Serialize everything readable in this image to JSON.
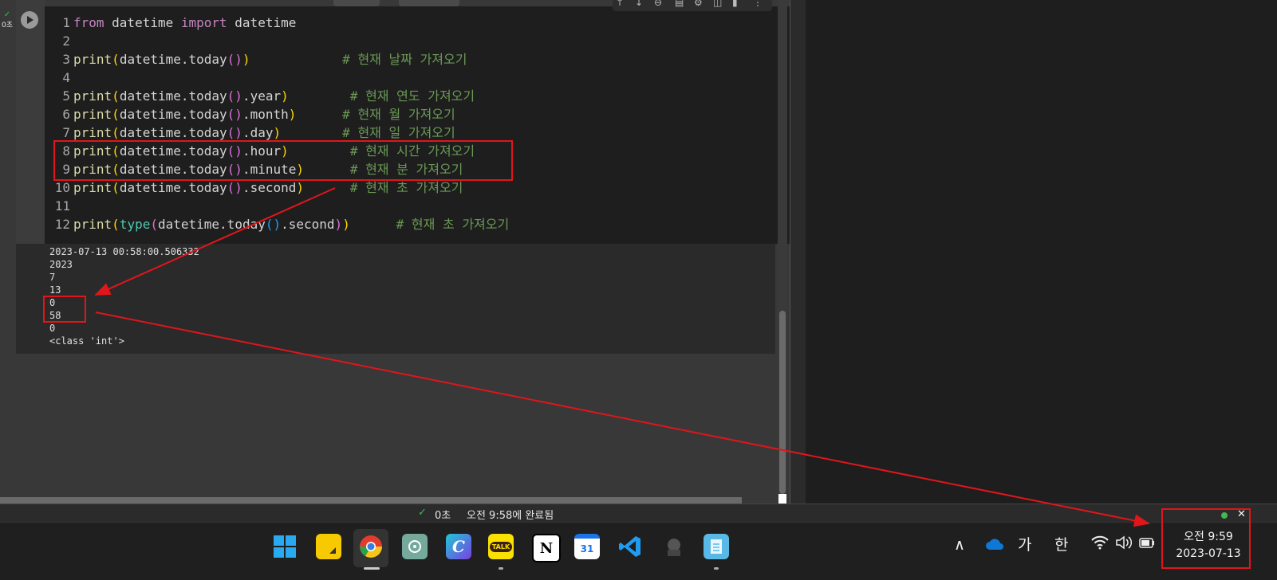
{
  "cell": {
    "status_check": "✓",
    "status_time": "0초",
    "run_icon": "play-icon",
    "toolbar_icons": [
      "arrow-up-icon",
      "arrow-down-icon",
      "link-icon",
      "comment-icon",
      "gear-icon",
      "mirror-icon",
      "trash-icon",
      "more-icon"
    ]
  },
  "code_lines": [
    {
      "n": "1",
      "segments": [
        [
          "kw",
          "from"
        ],
        [
          "tx",
          " datetime "
        ],
        [
          "kw",
          "import"
        ],
        [
          "tx",
          " datetime"
        ]
      ]
    },
    {
      "n": "2",
      "segments": []
    },
    {
      "n": "3",
      "segments": [
        [
          "fn",
          "print"
        ],
        [
          "p1",
          "("
        ],
        [
          "tx",
          "datetime.today"
        ],
        [
          "p2",
          "()"
        ],
        [
          "p1",
          ")"
        ],
        [
          "tx",
          "            "
        ],
        [
          "cm",
          "# 현재 날짜 가져오기"
        ]
      ]
    },
    {
      "n": "4",
      "segments": []
    },
    {
      "n": "5",
      "segments": [
        [
          "fn",
          "print"
        ],
        [
          "p1",
          "("
        ],
        [
          "tx",
          "datetime.today"
        ],
        [
          "p2",
          "()"
        ],
        [
          "tx",
          ".year"
        ],
        [
          "p1",
          ")"
        ],
        [
          "tx",
          "        "
        ],
        [
          "cm",
          "# 현재 연도 가져오기"
        ]
      ]
    },
    {
      "n": "6",
      "segments": [
        [
          "fn",
          "print"
        ],
        [
          "p1",
          "("
        ],
        [
          "tx",
          "datetime.today"
        ],
        [
          "p2",
          "()"
        ],
        [
          "tx",
          ".month"
        ],
        [
          "p1",
          ")"
        ],
        [
          "tx",
          "      "
        ],
        [
          "cm",
          "# 현재 월 가져오기"
        ]
      ]
    },
    {
      "n": "7",
      "segments": [
        [
          "fn",
          "print"
        ],
        [
          "p1",
          "("
        ],
        [
          "tx",
          "datetime.today"
        ],
        [
          "p2",
          "()"
        ],
        [
          "tx",
          ".day"
        ],
        [
          "p1",
          ")"
        ],
        [
          "tx",
          "        "
        ],
        [
          "cm",
          "# 현재 일 가져오기"
        ]
      ]
    },
    {
      "n": "8",
      "segments": [
        [
          "fn",
          "print"
        ],
        [
          "p1",
          "("
        ],
        [
          "tx",
          "datetime.today"
        ],
        [
          "p2",
          "()"
        ],
        [
          "tx",
          ".hour"
        ],
        [
          "p1",
          ")"
        ],
        [
          "tx",
          "        "
        ],
        [
          "cm",
          "# 현재 시간 가져오기"
        ]
      ]
    },
    {
      "n": "9",
      "segments": [
        [
          "fn",
          "print"
        ],
        [
          "p1",
          "("
        ],
        [
          "tx",
          "datetime.today"
        ],
        [
          "p2",
          "()"
        ],
        [
          "tx",
          ".minute"
        ],
        [
          "p1",
          ")"
        ],
        [
          "tx",
          "      "
        ],
        [
          "cm",
          "# 현재 분 가져오기"
        ]
      ]
    },
    {
      "n": "10",
      "segments": [
        [
          "fn",
          "print"
        ],
        [
          "p1",
          "("
        ],
        [
          "tx",
          "datetime.today"
        ],
        [
          "p2",
          "()"
        ],
        [
          "tx",
          ".second"
        ],
        [
          "p1",
          ")"
        ],
        [
          "tx",
          "      "
        ],
        [
          "cm",
          "# 현재 초 가져오기"
        ]
      ]
    },
    {
      "n": "11",
      "segments": []
    },
    {
      "n": "12",
      "segments": [
        [
          "fn",
          "print"
        ],
        [
          "p1",
          "("
        ],
        [
          "bi",
          "type"
        ],
        [
          "p2",
          "("
        ],
        [
          "tx",
          "datetime.today"
        ],
        [
          "p3",
          "()"
        ],
        [
          "tx",
          ".second"
        ],
        [
          "p2",
          ")"
        ],
        [
          "p1",
          ")"
        ],
        [
          "tx",
          "      "
        ],
        [
          "cm",
          "# 현재 초 가져오기"
        ]
      ]
    }
  ],
  "output_lines": [
    "2023-07-13 00:58:00.506332",
    "2023",
    "7",
    "13",
    "0",
    "58",
    "0",
    "<class 'int'>"
  ],
  "statusbar": {
    "check": "✓",
    "duration": "0초",
    "completed": "오전 9:58에 완료됨"
  },
  "taskbar": {
    "apps": [
      {
        "name": "windows-start-icon",
        "label": ""
      },
      {
        "name": "sticky-notes-icon",
        "label": ""
      },
      {
        "name": "chrome-icon",
        "label": ""
      },
      {
        "name": "chatgpt-icon",
        "label": ""
      },
      {
        "name": "canva-icon",
        "label": "C"
      },
      {
        "name": "kakaotalk-icon",
        "label": "TALK"
      },
      {
        "name": "notion-icon",
        "label": "N"
      },
      {
        "name": "calendar-icon",
        "label": "31"
      },
      {
        "name": "vscode-icon",
        "label": ""
      },
      {
        "name": "app-icon",
        "label": ""
      },
      {
        "name": "notepad-icon",
        "label": ""
      }
    ],
    "tray": {
      "chevron": "∧",
      "ime_1": "가",
      "ime_2": "한",
      "clock_time": "오전 9:59",
      "clock_date": "2023-07-13"
    }
  }
}
